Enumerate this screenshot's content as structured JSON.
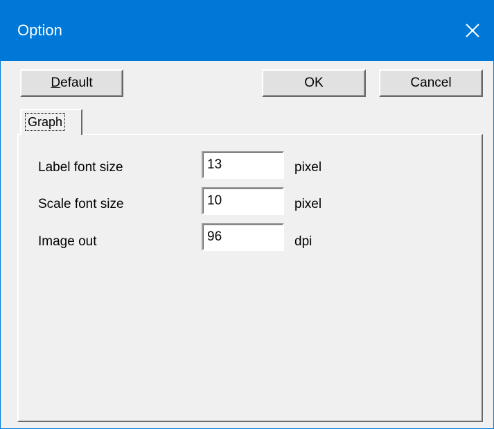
{
  "window": {
    "title": "Option",
    "close_icon": "close-icon"
  },
  "toolbar": {
    "default_label": "Default",
    "default_mnemonic": "D",
    "default_rest": "efault",
    "ok_label": "OK",
    "cancel_label": "Cancel"
  },
  "tabs": [
    {
      "label": "Graph",
      "selected": true
    }
  ],
  "graph": {
    "rows": [
      {
        "label": "Label font size",
        "value": "13",
        "unit": "pixel"
      },
      {
        "label": "Scale font size",
        "value": "10",
        "unit": "pixel"
      },
      {
        "label": "Image out",
        "value": "96",
        "unit": "dpi"
      }
    ]
  },
  "colors": {
    "titlebar": "#0078d7",
    "window_bg": "#f0f0f0",
    "button_bg": "#e1e1e1"
  }
}
